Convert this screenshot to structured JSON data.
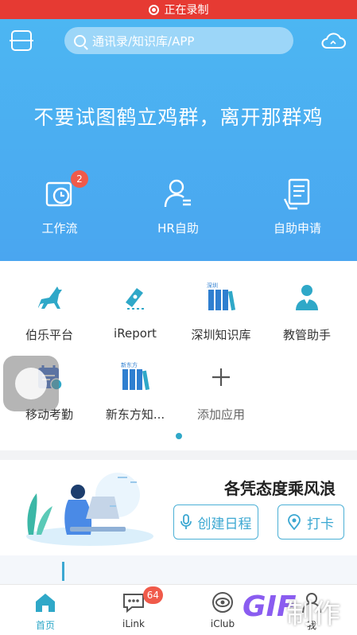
{
  "status_bar": {
    "recording_label": "正在录制"
  },
  "header": {
    "search_placeholder": "通讯录/知识库/APP"
  },
  "slogan": "不要试图鹤立鸡群，离开那群鸡",
  "quick_actions": [
    {
      "label": "工作流",
      "badge": "2"
    },
    {
      "label": "HR自助"
    },
    {
      "label": "自助申请"
    }
  ],
  "apps": [
    {
      "label": "伯乐平台"
    },
    {
      "label": "iReport"
    },
    {
      "label": "深圳知识库",
      "icon_caption": "深圳"
    },
    {
      "label": "教管助手"
    },
    {
      "label": "移动考勤"
    },
    {
      "label": "新东方知...",
      "icon_caption": "新东方"
    },
    {
      "label": "添加应用"
    }
  ],
  "promo": {
    "title": "各凭态度乘风浪",
    "schedule_button": "创建日程",
    "checkin_button": "打卡"
  },
  "tabs": [
    {
      "label": "首页"
    },
    {
      "label": "iLink",
      "badge": "64"
    },
    {
      "label": "iClub"
    },
    {
      "label": "我"
    }
  ],
  "watermark": {
    "text_1": "GIF",
    "text_2": "制作"
  },
  "colors": {
    "hero": "#4cb6f2",
    "accent": "#2fa8c8",
    "record": "#e63a33",
    "badge": "#f05a4a"
  }
}
